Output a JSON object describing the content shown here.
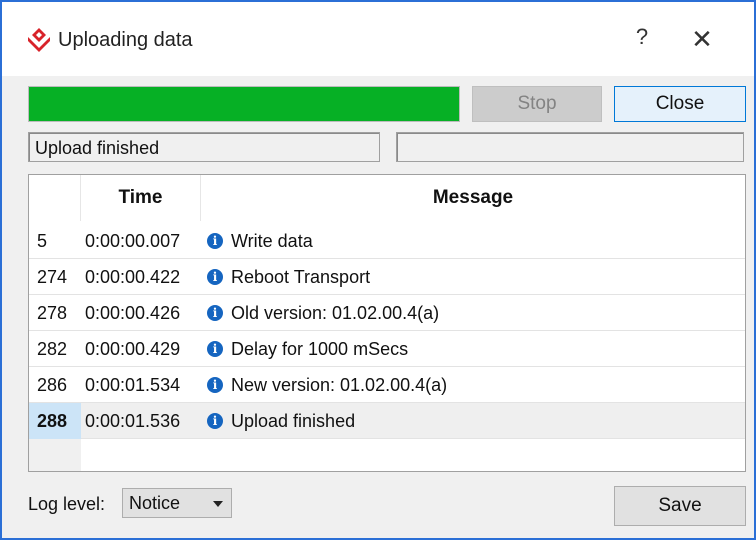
{
  "window": {
    "title": "Uploading data",
    "help_label": "?",
    "close_label": "✕",
    "logo_icon": "red-diamond-logo-icon"
  },
  "progress": {
    "fraction": 1.0,
    "color": "#06b025"
  },
  "buttons": {
    "stop": "Stop",
    "close": "Close",
    "save": "Save"
  },
  "status": {
    "left": "Upload finished",
    "right": ""
  },
  "table": {
    "columns": [
      "",
      "Time",
      "Message"
    ],
    "rows": [
      {
        "id": "5",
        "time": "0:00:00.007",
        "icon": "info-icon",
        "message": "Write data"
      },
      {
        "id": "274",
        "time": "0:00:00.422",
        "icon": "info-icon",
        "message": "Reboot Transport"
      },
      {
        "id": "278",
        "time": "0:00:00.426",
        "icon": "info-icon",
        "message": "Old version: 01.02.00.4(a)"
      },
      {
        "id": "282",
        "time": "0:00:00.429",
        "icon": "info-icon",
        "message": "Delay for 1000 mSecs"
      },
      {
        "id": "286",
        "time": "0:00:01.534",
        "icon": "info-icon",
        "message": "New version: 01.02.00.4(a)"
      },
      {
        "id": "288",
        "time": "0:00:01.536",
        "icon": "info-icon",
        "message": "Upload finished",
        "selected": true
      }
    ]
  },
  "footer": {
    "log_level_label": "Log level:",
    "log_level_value": "Notice"
  }
}
